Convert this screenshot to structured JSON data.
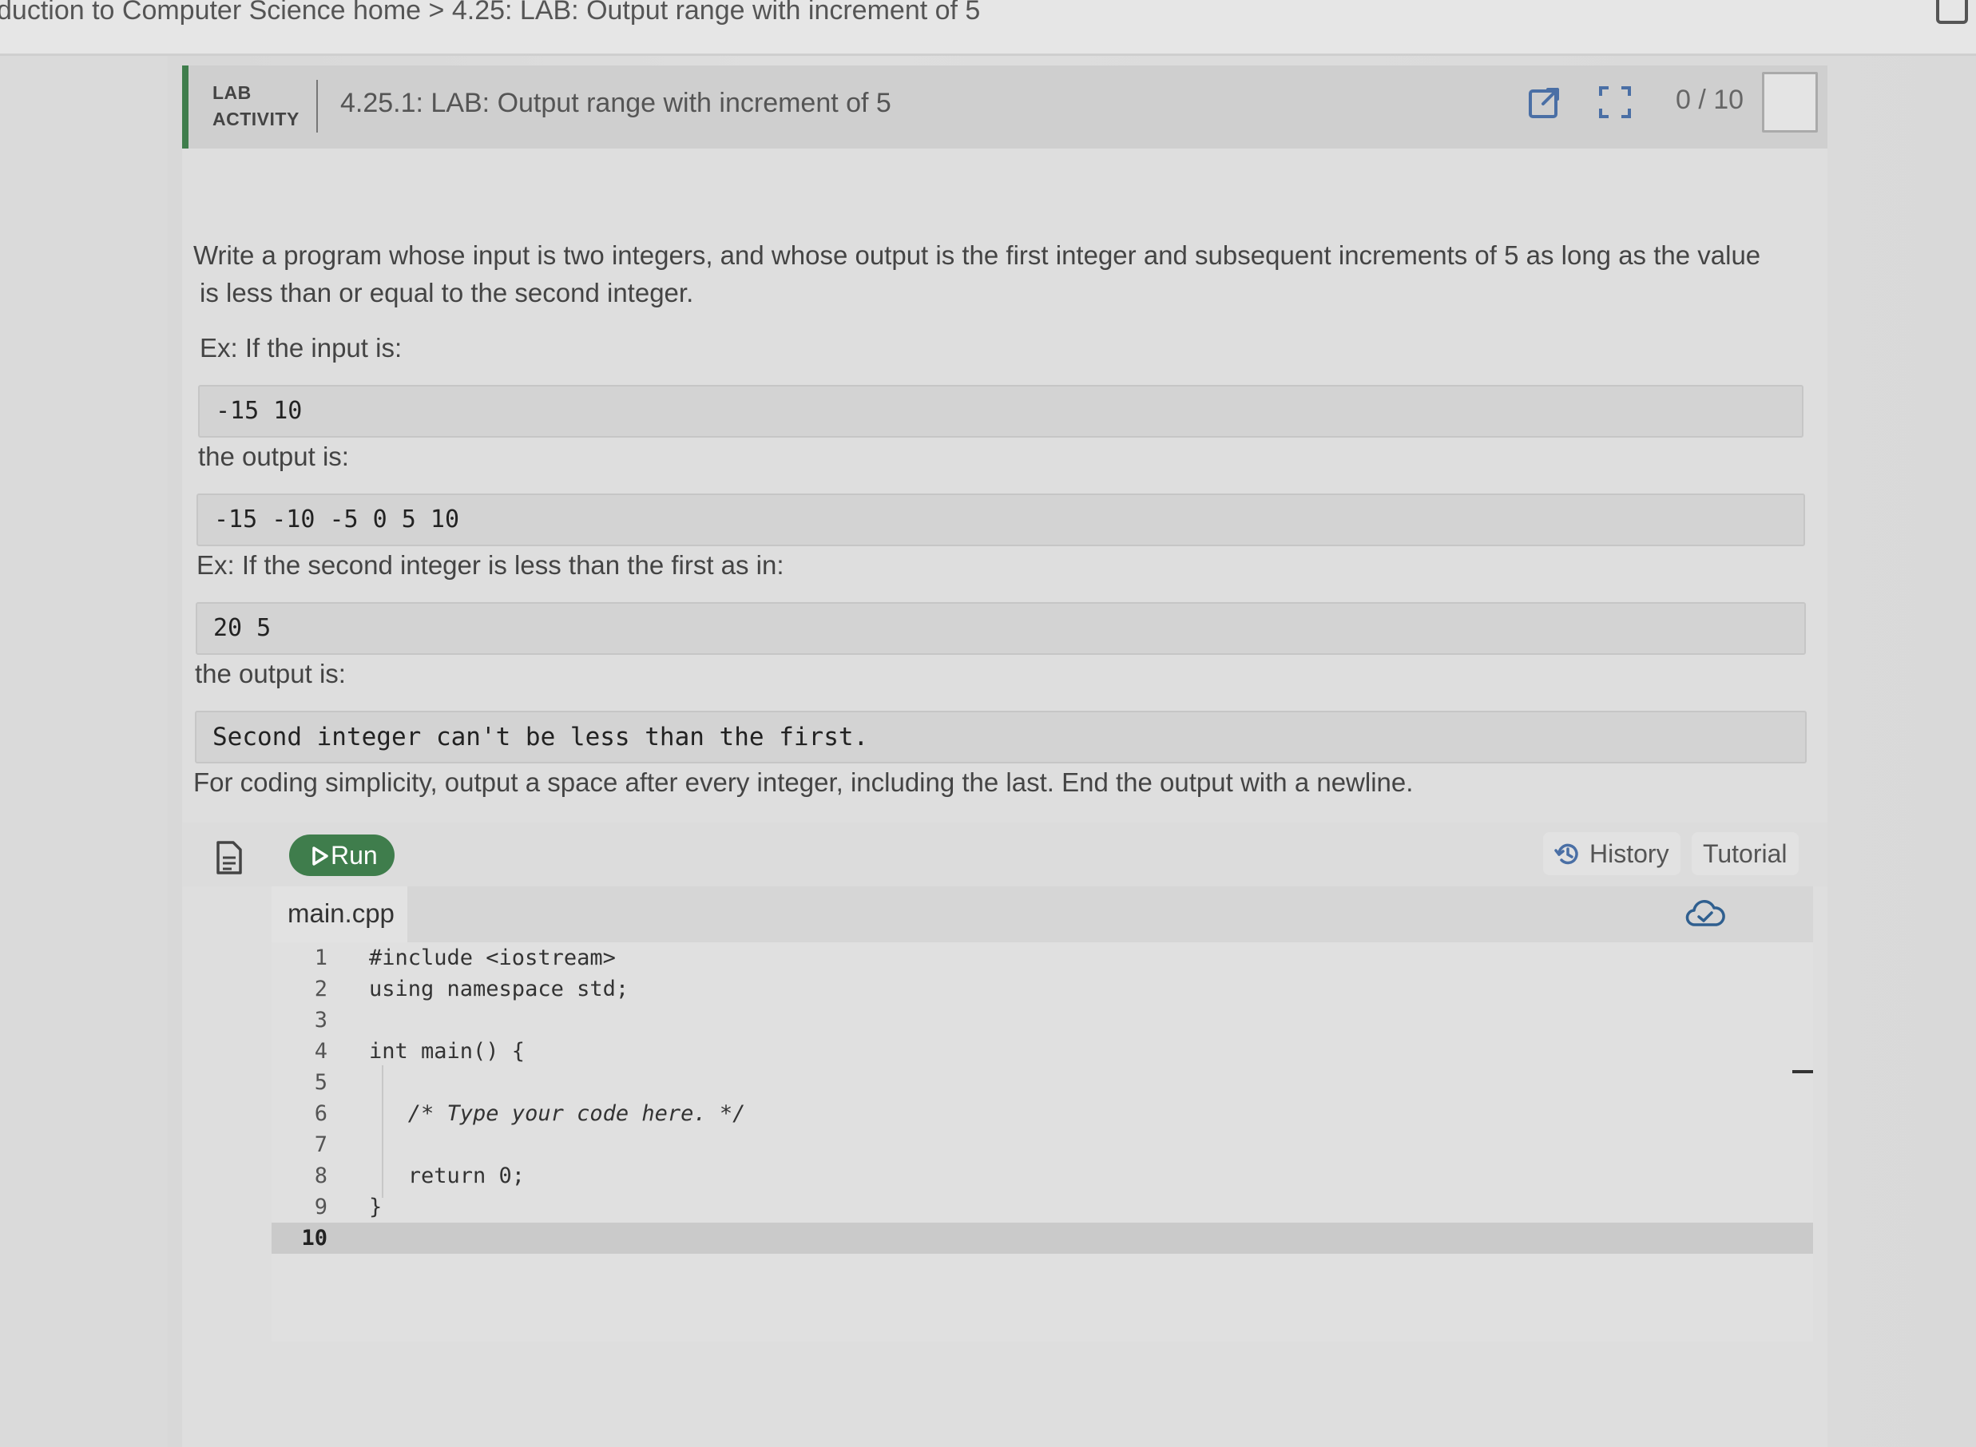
{
  "breadcrumb": {
    "course": "duction to Computer Science home",
    "separator": ">",
    "section": "4.25: LAB: Output range with increment of 5"
  },
  "activity": {
    "type_line1": "LAB",
    "type_line2": "ACTIVITY",
    "title": "4.25.1: LAB: Output range with increment of 5",
    "score": "0 / 10",
    "accent_color": "#3f7d4c"
  },
  "instructions": {
    "intro_line1": "Write a program whose input is two integers, and whose output is the first integer and subsequent increments of 5 as long as the value",
    "intro_line2": "is less than or equal to the second integer.",
    "ex1_label": "Ex: If the input is:",
    "ex1_input": "-15 10",
    "ex1_output_label": "the output is:",
    "ex1_output": "-15 -10 -5 0 5 10",
    "ex2_label": "Ex: If the second integer is less than the first as in:",
    "ex2_input": "20 5",
    "ex2_output_label": "the output is:",
    "ex2_output": "Second integer can't be less than the first.",
    "note": "For coding simplicity, output a space after every integer, including the last. End the output with a newline."
  },
  "toolbar": {
    "run_label": "Run",
    "history_label": "History",
    "tutorial_label": "Tutorial"
  },
  "editor": {
    "filename": "main.cpp",
    "lines": [
      {
        "num": "1",
        "code": "#include <iostream>"
      },
      {
        "num": "2",
        "code": "using namespace std;"
      },
      {
        "num": "3",
        "code": ""
      },
      {
        "num": "4",
        "code": "int main() {"
      },
      {
        "num": "5",
        "code": ""
      },
      {
        "num": "6",
        "code": "   /* Type your code here. */"
      },
      {
        "num": "7",
        "code": ""
      },
      {
        "num": "8",
        "code": "   return 0;"
      },
      {
        "num": "9",
        "code": "}"
      },
      {
        "num": "10",
        "code": ""
      }
    ]
  },
  "icons": {
    "open_new": "external-link-icon",
    "fullscreen": "fullscreen-icon",
    "file": "file-icon",
    "play": "play-icon",
    "history": "history-icon",
    "cloud": "cloud-check-icon"
  }
}
